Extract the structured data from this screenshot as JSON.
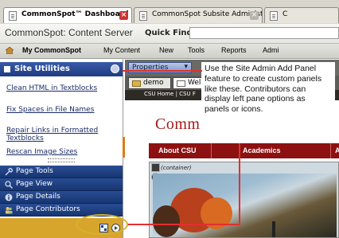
{
  "browser": {
    "tabs": [
      {
        "label": "CommonSpot™ Dashboard",
        "active": true
      },
      {
        "label": "CommonSpot Subsite Administ...",
        "active": false
      },
      {
        "label": "C",
        "active": false
      }
    ]
  },
  "header": {
    "app_title": "CommonSpot: Content Server",
    "quick_find_label": "Quick Find:",
    "quick_find_value": ""
  },
  "nav": {
    "items": [
      "My CommonSpot",
      "My Content",
      "New",
      "Tools",
      "Reports",
      "Admi"
    ]
  },
  "left_pane": {
    "utilities_title": "Site Utilities",
    "links": [
      "Clean HTML in Textblocks",
      "Fix Spaces in File Names",
      "Repair Links in Formatted Textblocks",
      "Rescan Image Sizes"
    ],
    "panels": [
      "Page Tools",
      "Page View",
      "Page Details",
      "Page Contributors"
    ]
  },
  "content": {
    "properties_label": "Properties",
    "folder_tabs": [
      "demo",
      "Welc"
    ],
    "breadcrumb": "CSU Home | CSU F",
    "site_logo_text": "Comm",
    "site_nav": [
      "About CSU",
      "Academics",
      "A"
    ],
    "container_label": "(container)"
  },
  "callout": {
    "text": "Use the Site Admin Add Panel feature to create custom panels like these. Contributors can display left pane options as panels or icons."
  },
  "colors": {
    "accent_blue": "#1f3b82",
    "csu_red": "#8d1111",
    "callout_line": "#e23030",
    "highlight_ring": "#d8b12a"
  }
}
